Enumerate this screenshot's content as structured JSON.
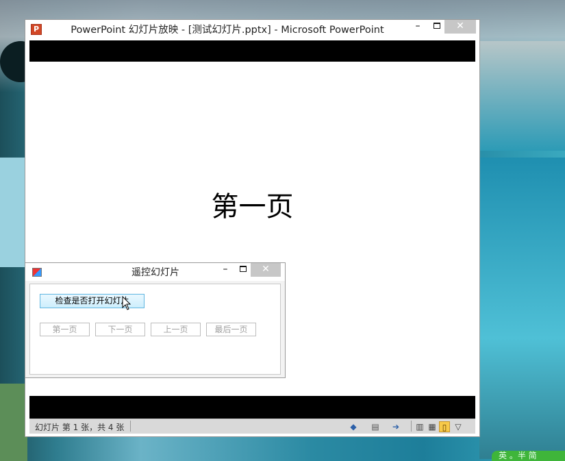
{
  "ppt_window": {
    "app_icon_letter": "P",
    "title": "PowerPoint 幻灯片放映 - [测试幻灯片.pptx] - Microsoft PowerPoint",
    "minimize": "–",
    "close": "✕"
  },
  "slide": {
    "text": "第一页"
  },
  "statusbar": {
    "slide_info": "幻灯片 第 1 张，共 4 张"
  },
  "remote_window": {
    "title": "遥控幻灯片",
    "minimize": "–",
    "close": "✕",
    "check_button": "检查是否打开幻灯片",
    "nav_buttons": [
      "第一页",
      "下一页",
      "上一页",
      "最后一页"
    ]
  },
  "taskbar_peek": "英 。半 简",
  "colors": {
    "close_button": "#c7c7c7",
    "active_button_border": "#5fb5e0",
    "status_bar": "#d9d9d9"
  },
  "icons": {
    "ppt_app": "powerpoint-icon",
    "remote_app": "window-app-icon",
    "status": [
      "previous-slide-icon",
      "slide-notes-icon",
      "next-slide-icon",
      "normal-view-icon",
      "slide-sorter-icon",
      "reading-view-icon",
      "slideshow-icon"
    ]
  }
}
